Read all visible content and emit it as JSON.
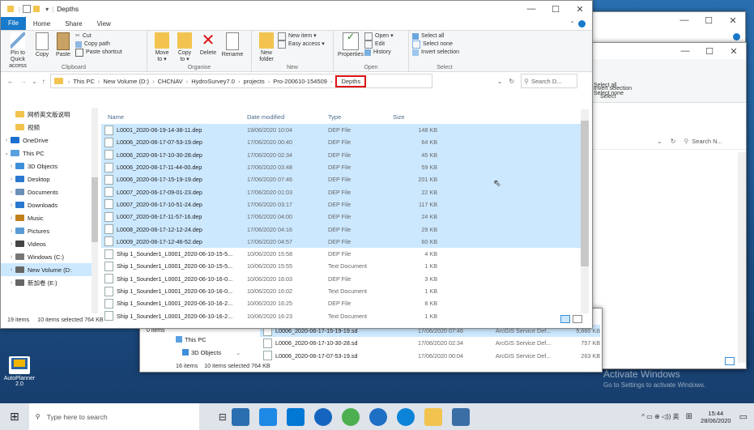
{
  "front_window": {
    "title": "Depths",
    "tabs": [
      "File",
      "Home",
      "Share",
      "View"
    ],
    "ribbon": {
      "clipboard": {
        "pin": "Pin to Quick access",
        "copy": "Copy",
        "paste": "Paste",
        "cut": "Cut",
        "copy_path": "Copy path",
        "paste_shortcut": "Paste shortcut",
        "name": "Clipboard"
      },
      "organise": {
        "move": "Move to ▾",
        "copy": "Copy to ▾",
        "delete": "Delete",
        "rename": "Rename",
        "name": "Organise"
      },
      "new": {
        "new_folder": "New folder",
        "new_item": "New item ▾",
        "easy_access": "Easy access ▾",
        "name": "New"
      },
      "open": {
        "properties": "Properties",
        "open": "Open ▾",
        "edit": "Edit",
        "history": "History",
        "name": "Open"
      },
      "select": {
        "select_all": "Select all",
        "select_none": "Select none",
        "invert": "Invert selection",
        "name": "Select"
      }
    },
    "breadcrumbs": [
      "This PC",
      "New Volume (D:)",
      "CHCNAV",
      "HydroSurvey7.0",
      "projects",
      "Pro-200610-154509"
    ],
    "current_folder": "Depths",
    "search_placeholder": "Search D...",
    "columns": {
      "name": "Name",
      "date": "Date modified",
      "type": "Type",
      "size": "Size"
    },
    "nav": [
      {
        "label": "网桥英文版说明",
        "indent": 1
      },
      {
        "label": "视频",
        "indent": 1
      },
      {
        "label": "OneDrive",
        "indent": 0
      },
      {
        "label": "This PC",
        "indent": 0
      },
      {
        "label": "3D Objects",
        "indent": 1
      },
      {
        "label": "Desktop",
        "indent": 1
      },
      {
        "label": "Documents",
        "indent": 1
      },
      {
        "label": "Downloads",
        "indent": 1
      },
      {
        "label": "Music",
        "indent": 1
      },
      {
        "label": "Pictures",
        "indent": 1
      },
      {
        "label": "Videos",
        "indent": 1
      },
      {
        "label": "Windows (C:)",
        "indent": 1
      },
      {
        "label": "New Volume (D:",
        "indent": 1
      },
      {
        "label": "新加卷 (E:)",
        "indent": 1
      }
    ],
    "files": [
      {
        "name": "L0001_2020-06-19-14-38-11.dep",
        "date": "19/06/2020 10:04",
        "type": "DEP File",
        "size": "148 KB",
        "sel": true
      },
      {
        "name": "L0006_2020-06-17-07-53-19.dep",
        "date": "17/06/2020 00:40",
        "type": "DEP File",
        "size": "64 KB",
        "sel": true
      },
      {
        "name": "L0006_2020-06-17-10-30-28.dep",
        "date": "17/06/2020 02:34",
        "type": "DEP File",
        "size": "45 KB",
        "sel": true
      },
      {
        "name": "L0006_2020-06-17-11-44-00.dep",
        "date": "17/06/2020 03:48",
        "type": "DEP File",
        "size": "59 KB",
        "sel": true
      },
      {
        "name": "L0006_2020-06-17-15-19-19.dep",
        "date": "17/06/2020 07:46",
        "type": "DEP File",
        "size": "201 KB",
        "sel": true
      },
      {
        "name": "L0007_2020-06-17-09-01-23.dep",
        "date": "17/06/2020 01:03",
        "type": "DEP File",
        "size": "22 KB",
        "sel": true
      },
      {
        "name": "L0007_2020-06-17-10-51-24.dep",
        "date": "17/06/2020 03:17",
        "type": "DEP File",
        "size": "117 KB",
        "sel": true
      },
      {
        "name": "L0007_2020-06-17-11-57-16.dep",
        "date": "17/06/2020 04:00",
        "type": "DEP File",
        "size": "24 KB",
        "sel": true
      },
      {
        "name": "L0008_2020-06-17-12-12-24.dep",
        "date": "17/06/2020 04:16",
        "type": "DEP File",
        "size": "29 KB",
        "sel": true
      },
      {
        "name": "L0009_2020-06-17-12-46-52.dep",
        "date": "17/06/2020 04:57",
        "type": "DEP File",
        "size": "60 KB",
        "sel": true
      },
      {
        "name": "Ship 1_Sounder1_L0001_2020-06-10-15-5...",
        "date": "10/06/2020 15:58",
        "type": "DEP File",
        "size": "4 KB",
        "sel": false
      },
      {
        "name": "Ship 1_Sounder1_L0001_2020-06-10-15-5...",
        "date": "10/06/2020 15:55",
        "type": "Text Document",
        "size": "1 KB",
        "sel": false
      },
      {
        "name": "Ship 1_Sounder1_L0001_2020-06-10-16-0...",
        "date": "10/06/2020 16:03",
        "type": "DEP File",
        "size": "3 KB",
        "sel": false
      },
      {
        "name": "Ship 1_Sounder1_L0001_2020-06-10-16-0...",
        "date": "10/06/2020 16:02",
        "type": "Text Document",
        "size": "1 KB",
        "sel": false
      },
      {
        "name": "Ship 1_Sounder1_L0001_2020-06-10-16-2...",
        "date": "10/06/2020 16:25",
        "type": "DEP File",
        "size": "8 KB",
        "sel": false
      },
      {
        "name": "Ship 1_Sounder1_L0001_2020-06-10-16-2...",
        "date": "10/06/2020 16:23",
        "type": "Text Document",
        "size": "1 KB",
        "sel": false
      }
    ],
    "status": {
      "items": "19 items",
      "selected": "10 items selected 764 KB"
    }
  },
  "mid_window": {
    "nav": [
      "This PC",
      "3D Objects"
    ],
    "status": {
      "items": "16 items",
      "selected": "10 items selected 764 KB",
      "left": "0 items"
    },
    "files": [
      {
        "name": "L0006_2020-06-17-15-19-19.sd",
        "date": "17/06/2020 07:46",
        "type": "ArcGIS Service Def...",
        "size": "5,660 KB"
      },
      {
        "name": "L0006_2020-06-17-10-30-28.sd",
        "date": "17/06/2020 02:34",
        "type": "ArcGIS Service Def...",
        "size": "757 KB"
      },
      {
        "name": "L0006_2020-06-17-07-53-19.sd",
        "date": "17/06/2020 00:04",
        "type": "ArcGIS Service Def...",
        "size": "263 KB"
      }
    ]
  },
  "back_window": {
    "select_all": "Select all",
    "select_none": "Select none",
    "invert": "Invert selection",
    "group": "Select",
    "search_placeholder": "Search N..."
  },
  "desktop": {
    "app_label": "AutoPlanner 2.0",
    "watermark_title": "Activate Windows",
    "watermark_sub": "Go to Settings to activate Windows."
  },
  "taskbar": {
    "search_placeholder": "Type here to search",
    "tray_text": "^ ▭ ⊕ ◁)) 英",
    "time": "15:44",
    "date": "28/06/2020",
    "colors": {
      "edge": "#1f6fc5",
      "chrome": "#4caf50",
      "store": "#0063b1",
      "explorer": "#f2c44f"
    }
  }
}
